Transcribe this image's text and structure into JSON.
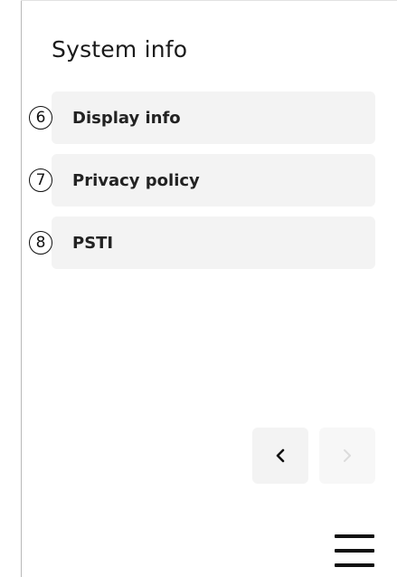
{
  "header": {
    "title": "System info"
  },
  "items": [
    {
      "badge": "6",
      "label": "Display info"
    },
    {
      "badge": "7",
      "label": "Privacy policy"
    },
    {
      "badge": "8",
      "label": "PSTI"
    }
  ],
  "nav": {
    "prev_icon": "chevron-left-icon",
    "next_icon": "chevron-right-icon",
    "next_disabled": true
  },
  "menu": {
    "icon": "hamburger-menu-icon"
  },
  "colors": {
    "row_background": "#f3f3f3",
    "text": "#222222",
    "disabled_icon": "#dcdcdc"
  }
}
